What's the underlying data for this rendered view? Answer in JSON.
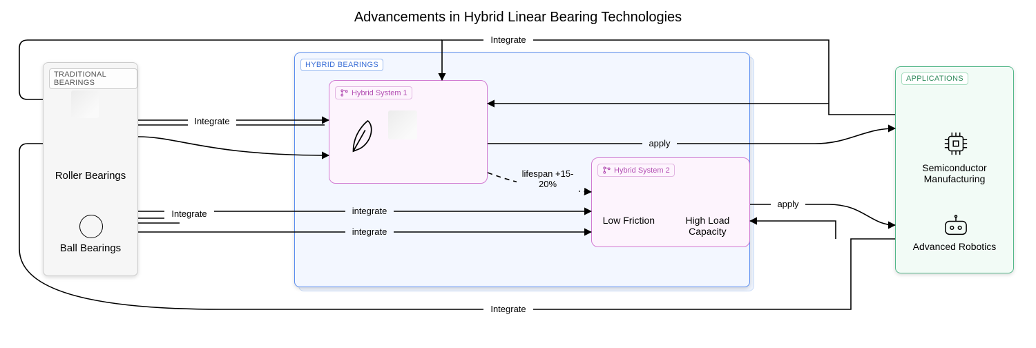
{
  "title": "Advancements in Hybrid Linear Bearing Technologies",
  "panels": {
    "traditional": {
      "label": "Traditional Bearings",
      "items": {
        "roller": "Roller Bearings",
        "ball": "Ball Bearings"
      }
    },
    "hybrid": {
      "label": "Hybrid Bearings",
      "system1": {
        "label": "Hybrid System 1"
      },
      "system2": {
        "label": "Hybrid System 2",
        "props": {
          "low_friction": "Low Friction",
          "high_load": "High Load Capacity"
        }
      }
    },
    "applications": {
      "label": "Applications",
      "items": {
        "semiconductor": "Semiconductor Manufacturing",
        "robotics": "Advanced Robotics"
      }
    }
  },
  "edges": {
    "integrate": "integrate",
    "integrate_cap": "Integrate",
    "apply": "apply",
    "lifespan": "lifespan +15-20%"
  }
}
